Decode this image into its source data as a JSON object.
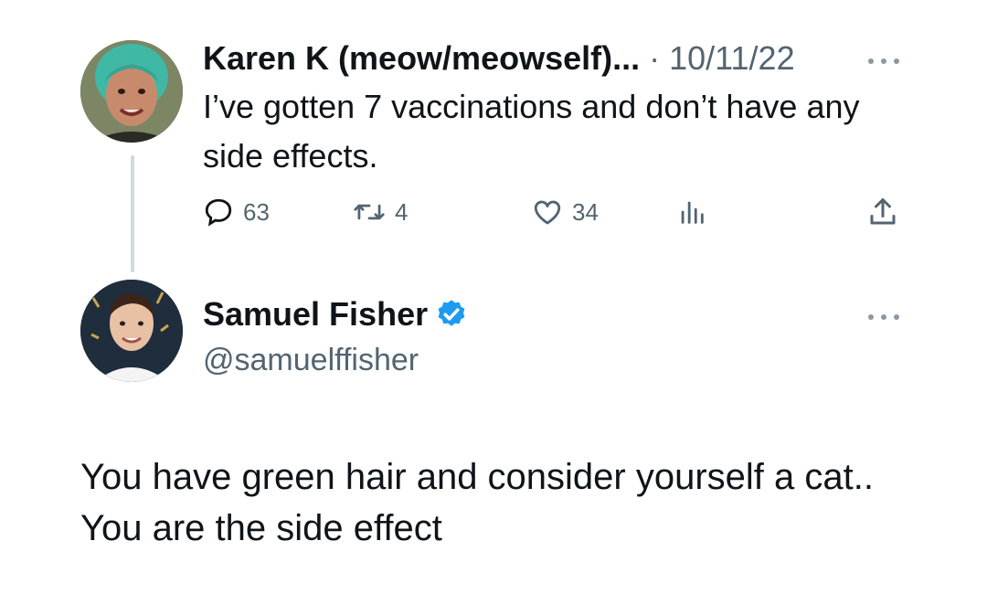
{
  "parent_tweet": {
    "author_name": "Karen K (meow/meowself)...",
    "separator": "·",
    "date": "10/11/22",
    "text": "I’ve gotten 7 vaccinations and don’t have any side effects.",
    "avatar_icon": "profile-photo-green-hair",
    "actions": {
      "reply_icon": "speech-bubble-icon",
      "reply_count": "63",
      "retweet_icon": "retweet-icon",
      "retweet_count": "4",
      "like_icon": "heart-icon",
      "like_count": "34",
      "views_icon": "bar-chart-icon",
      "share_icon": "share-upload-icon"
    }
  },
  "reply_tweet": {
    "author_name": "Samuel Fisher",
    "verified_icon": "verified-badge-icon",
    "handle": "@samuelffisher",
    "text": "You have green hair and consider yourself a cat.. You are the side effect",
    "avatar_icon": "profile-photo-man"
  },
  "colors": {
    "text_primary": "#0f1419",
    "text_secondary": "#536471",
    "verified_blue": "#1d9bf0",
    "thread_line": "#cfd9de"
  }
}
